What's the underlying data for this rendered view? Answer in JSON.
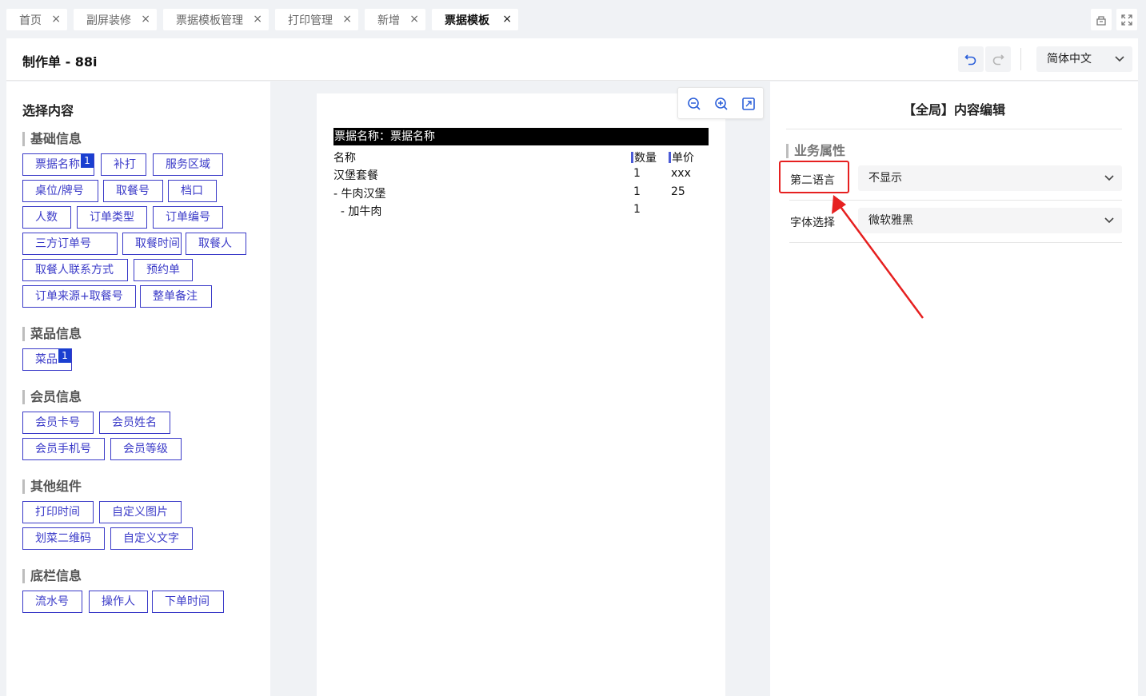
{
  "tabs": [
    {
      "label": "首页",
      "active": false
    },
    {
      "label": "副屏装修",
      "active": false
    },
    {
      "label": "票据模板管理",
      "active": false
    },
    {
      "label": "打印管理",
      "active": false
    },
    {
      "label": "新增",
      "active": false
    },
    {
      "label": "票据模板",
      "active": true
    }
  ],
  "tab_close": "×",
  "tab_icons": [
    "home-cabinet-icon",
    "fullscreen-icon"
  ],
  "header": {
    "title": "制作单 - 88i",
    "undo_icon": "undo-icon",
    "redo_icon": "redo-icon",
    "language": "简体中文"
  },
  "left": {
    "title": "选择内容",
    "sections": [
      {
        "title": "基础信息",
        "chips": [
          {
            "label": "票据名称",
            "badge": "1"
          },
          {
            "label": "补打"
          },
          {
            "label": "服务区域"
          },
          {
            "label": "桌位/牌号"
          },
          {
            "label": "取餐号"
          },
          {
            "label": "档口"
          },
          {
            "label": "人数"
          },
          {
            "label": "订单类型"
          },
          {
            "label": "订单编号"
          },
          {
            "label": "三方订单号"
          },
          {
            "label": "取餐时间"
          },
          {
            "label": "取餐人"
          },
          {
            "label": "取餐人联系方式"
          },
          {
            "label": "预约单"
          },
          {
            "label": "订单来源+取餐号"
          },
          {
            "label": "整单备注"
          }
        ]
      },
      {
        "title": "菜品信息",
        "chips": [
          {
            "label": "菜品",
            "badge": "1"
          }
        ]
      },
      {
        "title": "会员信息",
        "chips": [
          {
            "label": "会员卡号"
          },
          {
            "label": "会员姓名"
          },
          {
            "label": "会员手机号"
          },
          {
            "label": "会员等级"
          }
        ]
      },
      {
        "title": "其他组件",
        "chips": [
          {
            "label": "打印时间"
          },
          {
            "label": "自定义图片"
          },
          {
            "label": "划菜二维码"
          },
          {
            "label": "自定义文字"
          }
        ]
      },
      {
        "title": "底栏信息",
        "chips": [
          {
            "label": "流水号"
          },
          {
            "label": "操作人"
          },
          {
            "label": "下单时间"
          }
        ]
      }
    ]
  },
  "canvas": {
    "zoom_icons": [
      "zoom-out-icon",
      "zoom-in-icon",
      "fit-screen-icon"
    ],
    "receipt": {
      "title_bar": "票据名称：票据名称",
      "headers": [
        "名称",
        "数量",
        "单价"
      ],
      "rows": [
        [
          "汉堡套餐",
          "1",
          "xxx"
        ],
        [
          "- 牛肉汉堡",
          "1",
          "25"
        ],
        [
          "  - 加牛肉",
          "1",
          ""
        ]
      ]
    }
  },
  "right": {
    "title": "【全局】内容编辑",
    "section": "业务属性",
    "props": [
      {
        "label": "第二语言",
        "value": "不显示"
      },
      {
        "label": "字体选择",
        "value": "微软雅黑"
      }
    ],
    "highlight_color": "#e62020"
  },
  "colors": {
    "chip_border": "#3a3ac8",
    "badge": "#1a3fd0",
    "undo_accent": "#2b5fd9"
  }
}
